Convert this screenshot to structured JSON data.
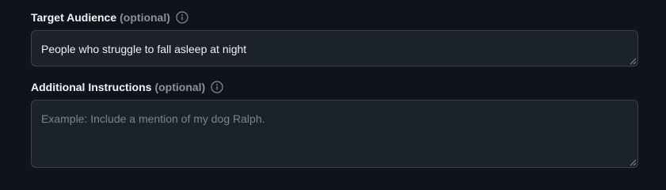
{
  "target_audience": {
    "label": "Target Audience",
    "optional": "(optional)",
    "value": "People who struggle to fall asleep at night",
    "info_icon": "info-circle-icon"
  },
  "additional_instructions": {
    "label": "Additional Instructions",
    "optional": "(optional)",
    "placeholder": "Example: Include a mention of my dog Ralph.",
    "info_icon": "info-circle-icon"
  },
  "colors": {
    "background": "#0f131b",
    "input_background": "#1c222c",
    "input_border": "#3a414d",
    "label": "#f1f3f6",
    "muted": "#8a919e"
  }
}
